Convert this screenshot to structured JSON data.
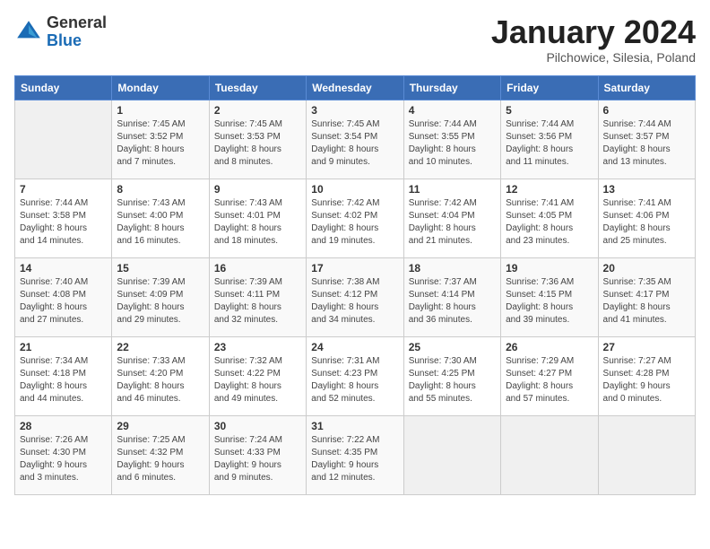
{
  "header": {
    "logo_line1": "General",
    "logo_line2": "Blue",
    "month_title": "January 2024",
    "subtitle": "Pilchowice, Silesia, Poland"
  },
  "weekdays": [
    "Sunday",
    "Monday",
    "Tuesday",
    "Wednesday",
    "Thursday",
    "Friday",
    "Saturday"
  ],
  "weeks": [
    [
      {
        "day": "",
        "info": ""
      },
      {
        "day": "1",
        "info": "Sunrise: 7:45 AM\nSunset: 3:52 PM\nDaylight: 8 hours\nand 7 minutes."
      },
      {
        "day": "2",
        "info": "Sunrise: 7:45 AM\nSunset: 3:53 PM\nDaylight: 8 hours\nand 8 minutes."
      },
      {
        "day": "3",
        "info": "Sunrise: 7:45 AM\nSunset: 3:54 PM\nDaylight: 8 hours\nand 9 minutes."
      },
      {
        "day": "4",
        "info": "Sunrise: 7:44 AM\nSunset: 3:55 PM\nDaylight: 8 hours\nand 10 minutes."
      },
      {
        "day": "5",
        "info": "Sunrise: 7:44 AM\nSunset: 3:56 PM\nDaylight: 8 hours\nand 11 minutes."
      },
      {
        "day": "6",
        "info": "Sunrise: 7:44 AM\nSunset: 3:57 PM\nDaylight: 8 hours\nand 13 minutes."
      }
    ],
    [
      {
        "day": "7",
        "info": "Sunrise: 7:44 AM\nSunset: 3:58 PM\nDaylight: 8 hours\nand 14 minutes."
      },
      {
        "day": "8",
        "info": "Sunrise: 7:43 AM\nSunset: 4:00 PM\nDaylight: 8 hours\nand 16 minutes."
      },
      {
        "day": "9",
        "info": "Sunrise: 7:43 AM\nSunset: 4:01 PM\nDaylight: 8 hours\nand 18 minutes."
      },
      {
        "day": "10",
        "info": "Sunrise: 7:42 AM\nSunset: 4:02 PM\nDaylight: 8 hours\nand 19 minutes."
      },
      {
        "day": "11",
        "info": "Sunrise: 7:42 AM\nSunset: 4:04 PM\nDaylight: 8 hours\nand 21 minutes."
      },
      {
        "day": "12",
        "info": "Sunrise: 7:41 AM\nSunset: 4:05 PM\nDaylight: 8 hours\nand 23 minutes."
      },
      {
        "day": "13",
        "info": "Sunrise: 7:41 AM\nSunset: 4:06 PM\nDaylight: 8 hours\nand 25 minutes."
      }
    ],
    [
      {
        "day": "14",
        "info": "Sunrise: 7:40 AM\nSunset: 4:08 PM\nDaylight: 8 hours\nand 27 minutes."
      },
      {
        "day": "15",
        "info": "Sunrise: 7:39 AM\nSunset: 4:09 PM\nDaylight: 8 hours\nand 29 minutes."
      },
      {
        "day": "16",
        "info": "Sunrise: 7:39 AM\nSunset: 4:11 PM\nDaylight: 8 hours\nand 32 minutes."
      },
      {
        "day": "17",
        "info": "Sunrise: 7:38 AM\nSunset: 4:12 PM\nDaylight: 8 hours\nand 34 minutes."
      },
      {
        "day": "18",
        "info": "Sunrise: 7:37 AM\nSunset: 4:14 PM\nDaylight: 8 hours\nand 36 minutes."
      },
      {
        "day": "19",
        "info": "Sunrise: 7:36 AM\nSunset: 4:15 PM\nDaylight: 8 hours\nand 39 minutes."
      },
      {
        "day": "20",
        "info": "Sunrise: 7:35 AM\nSunset: 4:17 PM\nDaylight: 8 hours\nand 41 minutes."
      }
    ],
    [
      {
        "day": "21",
        "info": "Sunrise: 7:34 AM\nSunset: 4:18 PM\nDaylight: 8 hours\nand 44 minutes."
      },
      {
        "day": "22",
        "info": "Sunrise: 7:33 AM\nSunset: 4:20 PM\nDaylight: 8 hours\nand 46 minutes."
      },
      {
        "day": "23",
        "info": "Sunrise: 7:32 AM\nSunset: 4:22 PM\nDaylight: 8 hours\nand 49 minutes."
      },
      {
        "day": "24",
        "info": "Sunrise: 7:31 AM\nSunset: 4:23 PM\nDaylight: 8 hours\nand 52 minutes."
      },
      {
        "day": "25",
        "info": "Sunrise: 7:30 AM\nSunset: 4:25 PM\nDaylight: 8 hours\nand 55 minutes."
      },
      {
        "day": "26",
        "info": "Sunrise: 7:29 AM\nSunset: 4:27 PM\nDaylight: 8 hours\nand 57 minutes."
      },
      {
        "day": "27",
        "info": "Sunrise: 7:27 AM\nSunset: 4:28 PM\nDaylight: 9 hours\nand 0 minutes."
      }
    ],
    [
      {
        "day": "28",
        "info": "Sunrise: 7:26 AM\nSunset: 4:30 PM\nDaylight: 9 hours\nand 3 minutes."
      },
      {
        "day": "29",
        "info": "Sunrise: 7:25 AM\nSunset: 4:32 PM\nDaylight: 9 hours\nand 6 minutes."
      },
      {
        "day": "30",
        "info": "Sunrise: 7:24 AM\nSunset: 4:33 PM\nDaylight: 9 hours\nand 9 minutes."
      },
      {
        "day": "31",
        "info": "Sunrise: 7:22 AM\nSunset: 4:35 PM\nDaylight: 9 hours\nand 12 minutes."
      },
      {
        "day": "",
        "info": ""
      },
      {
        "day": "",
        "info": ""
      },
      {
        "day": "",
        "info": ""
      }
    ]
  ]
}
